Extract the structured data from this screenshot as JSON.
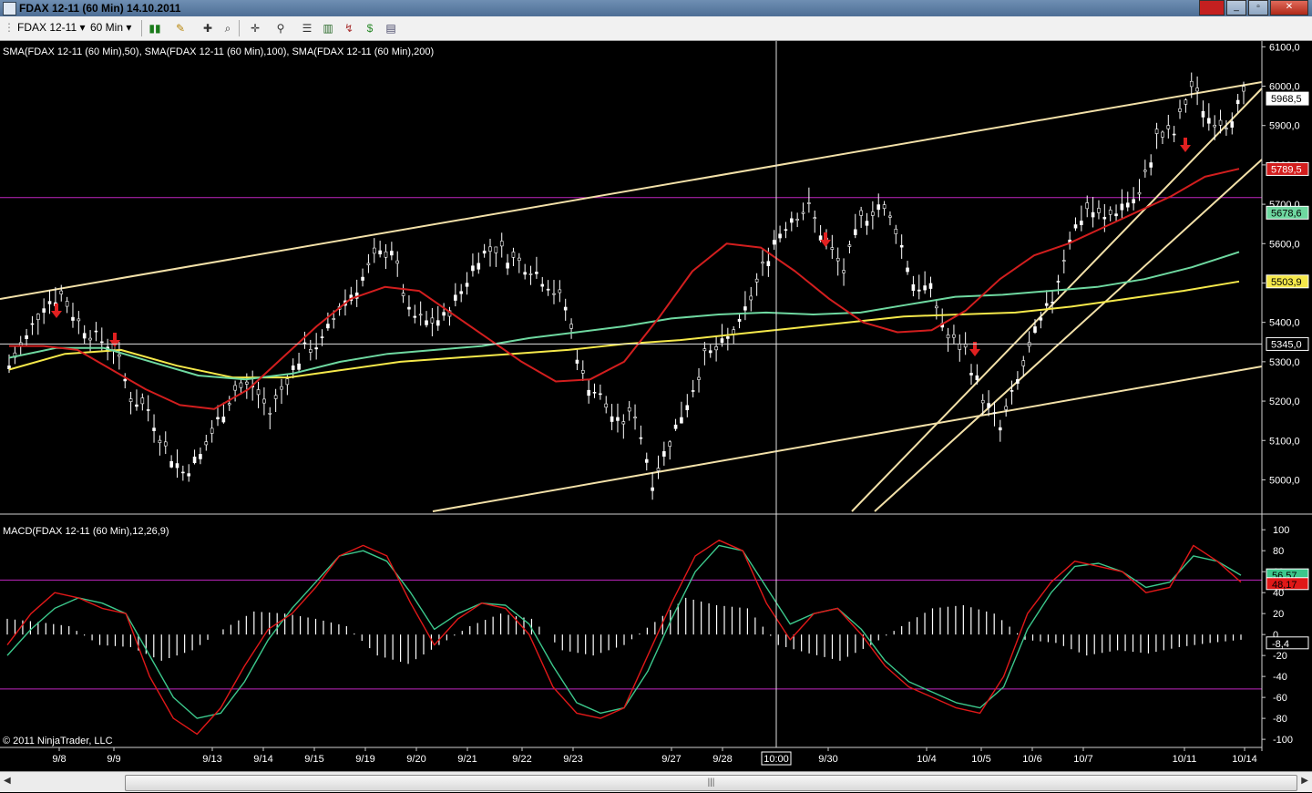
{
  "window": {
    "title": "FDAX 12-11 (60 Min)  14.10.2011"
  },
  "toolbar": {
    "instrument": "FDAX 12-11",
    "period": "60 Min"
  },
  "chart": {
    "price_panel_label": "SMA(FDAX 12-11 (60 Min),50), SMA(FDAX 12-11 (60 Min),100), SMA(FDAX 12-11 (60 Min),200)",
    "macd_panel_label": "MACD(FDAX 12-11 (60 Min),12,26,9)",
    "copyright": "© 2011 NinjaTrader, LLC",
    "crosshair_time_label": "10:00"
  },
  "chart_data": [
    {
      "type": "line",
      "title": "",
      "x_ticks": [
        "9/8",
        "9/9",
        "9/13",
        "9/14",
        "9/15",
        "9/19",
        "9/20",
        "9/21",
        "9/22",
        "9/23",
        "9/27",
        "9/28",
        "9/30",
        "10/4",
        "10/5",
        "10/6",
        "10/7",
        "10/11",
        "10/14"
      ],
      "y_ticks": [
        5000,
        5100,
        5200,
        5300,
        5400,
        5500,
        5600,
        5700,
        5800,
        5900,
        6000,
        6100
      ],
      "y_tick_labels": [
        "5000,0",
        "5100,0",
        "5200,0",
        "5300,0",
        "5400,0",
        "5500,0",
        "5600,0",
        "5700,0",
        "5800,0",
        "5900,0",
        "6000,0",
        "6100,0"
      ],
      "ylim": [
        4920,
        6110
      ],
      "series": [
        {
          "name": "FDAX 12-11 close",
          "color": "#ffffff",
          "values": [
            5290,
            5360,
            5450,
            5470,
            5400,
            5360,
            5340,
            5210,
            5180,
            5080,
            5020,
            5060,
            5150,
            5230,
            5240,
            5170,
            5260,
            5330,
            5350,
            5440,
            5490,
            5560,
            5590,
            5420,
            5400,
            5410,
            5480,
            5570,
            5590,
            5560,
            5540,
            5500,
            5440,
            5260,
            5210,
            5140,
            5170,
            5000,
            5100,
            5200,
            5310,
            5340,
            5390,
            5500,
            5610,
            5670,
            5690,
            5600,
            5530,
            5660,
            5700,
            5640,
            5500,
            5480,
            5360,
            5330,
            5210,
            5130,
            5250,
            5370,
            5460,
            5620,
            5690,
            5660,
            5700,
            5720,
            5870,
            5880,
            6000,
            5920,
            5910,
            5968
          ]
        },
        {
          "name": "SMA 50",
          "color": "#d21e1e",
          "values": [
            5340,
            5340,
            5330,
            5280,
            5230,
            5190,
            5180,
            5230,
            5310,
            5390,
            5460,
            5490,
            5480,
            5420,
            5360,
            5300,
            5250,
            5255,
            5300,
            5410,
            5530,
            5600,
            5590,
            5530,
            5460,
            5400,
            5375,
            5380,
            5430,
            5510,
            5570,
            5600,
            5640,
            5680,
            5720,
            5770,
            5790
          ]
        },
        {
          "name": "SMA 100",
          "color": "#6ed8a0",
          "values": [
            5310,
            5335,
            5335,
            5300,
            5265,
            5255,
            5270,
            5300,
            5320,
            5330,
            5340,
            5360,
            5375,
            5390,
            5410,
            5420,
            5425,
            5420,
            5425,
            5445,
            5465,
            5470,
            5480,
            5490,
            5510,
            5540,
            5579
          ]
        },
        {
          "name": "SMA 200",
          "color": "#f5e84a",
          "values": [
            5280,
            5320,
            5330,
            5290,
            5260,
            5260,
            5280,
            5300,
            5310,
            5320,
            5330,
            5345,
            5355,
            5370,
            5385,
            5400,
            5415,
            5420,
            5425,
            5440,
            5460,
            5480,
            5504
          ]
        }
      ],
      "value_labels": [
        "5968,5",
        "5789,5",
        "5678,6",
        "5503,9",
        "5345,0"
      ],
      "label_colors": [
        "#ffffff",
        "#d21e1e",
        "#6ed8a0",
        "#f5e84a",
        "#ffffff"
      ],
      "horizontal_line": 5717,
      "horizontal_line_color": "#c026c0",
      "grid": false
    },
    {
      "type": "line",
      "title": "",
      "y_ticks": [
        -100,
        -80,
        -60,
        -40,
        -20,
        0,
        20,
        40,
        60,
        80,
        100
      ],
      "y_tick_labels": [
        "-100",
        "-80",
        "-60",
        "-40",
        "-20",
        "0",
        "20",
        "40",
        "60",
        "80",
        "100"
      ],
      "ylim": [
        -106,
        108
      ],
      "series": [
        {
          "name": "MACD",
          "color": "#e01818",
          "values": [
            -10,
            20,
            40,
            35,
            25,
            20,
            -40,
            -80,
            -95,
            -70,
            -30,
            5,
            20,
            45,
            75,
            85,
            75,
            30,
            -10,
            15,
            30,
            25,
            0,
            -50,
            -75,
            -80,
            -70,
            -20,
            30,
            75,
            90,
            80,
            30,
            -5,
            20,
            25,
            0,
            -30,
            -50,
            -60,
            -70,
            -75,
            -40,
            20,
            50,
            70,
            65,
            60,
            40,
            45,
            85,
            70,
            50
          ]
        },
        {
          "name": "Signal",
          "color": "#3cc88c",
          "values": [
            -20,
            5,
            25,
            35,
            30,
            20,
            -20,
            -60,
            -80,
            -75,
            -45,
            -5,
            25,
            50,
            75,
            80,
            70,
            40,
            5,
            20,
            30,
            28,
            10,
            -30,
            -65,
            -75,
            -70,
            -35,
            15,
            60,
            85,
            80,
            45,
            10,
            20,
            25,
            5,
            -25,
            -45,
            -55,
            -65,
            -70,
            -50,
            5,
            40,
            65,
            68,
            60,
            45,
            50,
            75,
            70,
            56.6
          ]
        },
        {
          "name": "Histogram",
          "color": "#ffffff",
          "values": [
            15,
            12,
            8,
            -10,
            -12,
            -25,
            -15,
            5,
            22,
            20,
            15,
            8,
            -20,
            -28,
            -10,
            8,
            20,
            15,
            -15,
            -20,
            -10,
            12,
            35,
            28,
            25,
            -10,
            -18,
            -25,
            -10,
            8,
            25,
            28,
            20,
            -5,
            -8,
            -20,
            -15,
            -18,
            -12,
            -8,
            -5
          ]
        }
      ],
      "value_labels": [
        "56,57",
        "48,17",
        "-8,4"
      ],
      "label_colors": [
        "#3cc88c",
        "#e01818",
        "#ffffff"
      ],
      "horizontal_lines": [
        52,
        -52
      ],
      "horizontal_line_color": "#c026c0",
      "grid": false
    }
  ]
}
